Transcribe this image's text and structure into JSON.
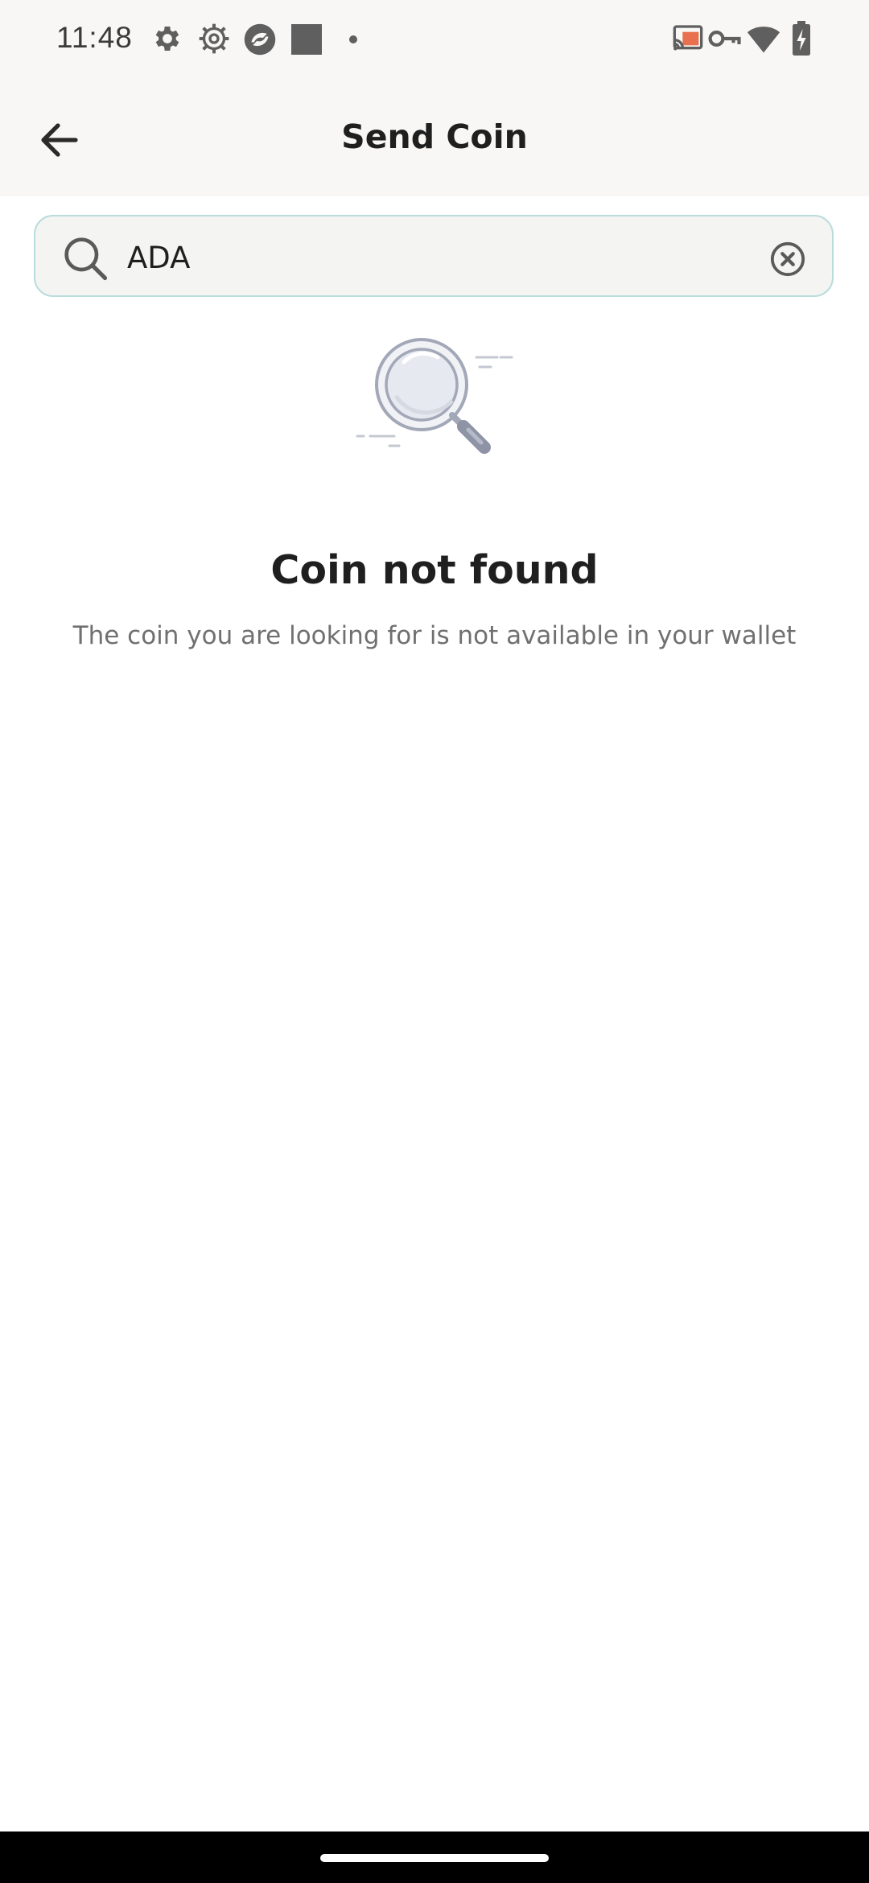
{
  "status_bar": {
    "time": "11:48",
    "left_icons": [
      "settings-icon",
      "gear-outline-icon",
      "app-icon",
      "square-icon",
      "dot-icon"
    ],
    "right_icons": [
      "cast-icon",
      "vpn-key-icon",
      "wifi-icon",
      "battery-charging-icon"
    ]
  },
  "app_bar": {
    "title": "Send Coin",
    "back_icon": "arrow-back-icon"
  },
  "search": {
    "value": "ADA",
    "placeholder": "",
    "icon": "search-icon",
    "clear_icon": "clear-circle-icon",
    "border_color": "#b9dcdc",
    "background_color": "#f4f4f3"
  },
  "empty_state": {
    "icon": "magnifier-illustration-icon",
    "title": "Coin not found",
    "subtitle": "The coin you are looking for is not available in your wallet"
  },
  "colors": {
    "bar_background": "#f8f7f5",
    "title_text": "#1f1f1f",
    "subtitle_text": "#707070",
    "nav_bar": "#000000"
  }
}
